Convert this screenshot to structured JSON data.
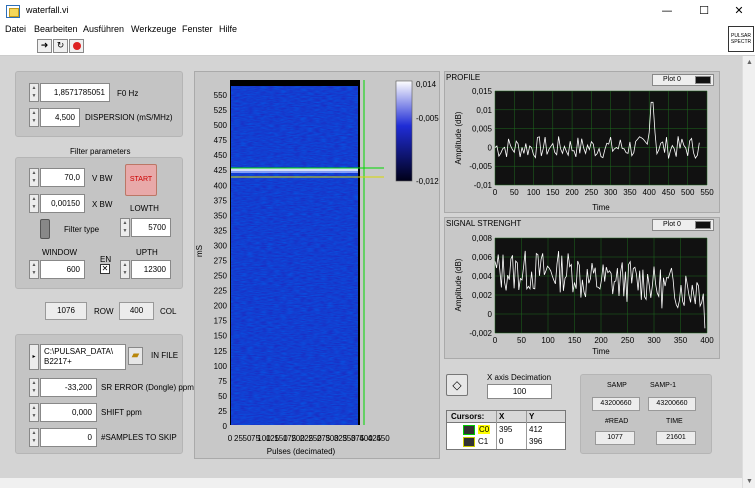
{
  "window": {
    "title": "waterfall.vi"
  },
  "menu": [
    "Datei",
    "Bearbeiten",
    "Ausführen",
    "Werkzeuge",
    "Fenster",
    "Hilfe"
  ],
  "logo": "PULSAR SPECTR",
  "controls": {
    "f0": {
      "value": "1,8571785051",
      "label": "F0 Hz"
    },
    "dispersion": {
      "value": "4,500",
      "label": "DISPERSION (mS/MHz)"
    },
    "filter_title": "Filter parameters",
    "vbw": {
      "value": "70,0",
      "label": "V BW"
    },
    "xbw": {
      "value": "0,00150",
      "label": "X BW"
    },
    "start_label": "START",
    "lowth": {
      "value": "5700",
      "label": "LOWTH"
    },
    "filter_type": "Filter type",
    "window": {
      "value": "600",
      "label": "WINDOW"
    },
    "en": "EN",
    "upth": {
      "value": "12300",
      "label": "UPTH"
    },
    "row": {
      "value": "1076",
      "label": "ROW"
    },
    "col": {
      "value": "400",
      "label": "COL"
    },
    "infile": {
      "value": "C:\\PULSAR_DATA\\ B2217+",
      "label": "IN FILE"
    },
    "sr_error": {
      "value": "-33,200",
      "label": "SR ERROR (Dongle) ppm"
    },
    "shift": {
      "value": "0,000",
      "label": "SHIFT ppm"
    },
    "skip": {
      "value": "0",
      "label": "#SAMPLES TO SKIP"
    }
  },
  "waterfall": {
    "ylabel": "mS",
    "xlabel": "Pulses (decimated)",
    "yticks": [
      "0",
      "25",
      "50",
      "75",
      "100",
      "125",
      "150",
      "175",
      "200",
      "225",
      "250",
      "275",
      "300",
      "325",
      "350",
      "375",
      "400",
      "425",
      "450",
      "475",
      "500",
      "525",
      "550"
    ],
    "xticks": [
      "0",
      "25",
      "50",
      "75",
      "100",
      "125",
      "150",
      "175",
      "200",
      "225",
      "250",
      "275",
      "300",
      "325",
      "350",
      "375",
      "400",
      "425",
      "450"
    ],
    "colorbar": [
      "0,014",
      "-0,005",
      "-0,012"
    ],
    "pulse_row_ms": 400,
    "cursor_x": 395,
    "cursor_y": 412
  },
  "profile": {
    "title": "PROFILE",
    "plot_label": "Plot 0",
    "ylabel": "Amplitude (dB)",
    "xlabel": "Time",
    "yticks": [
      "0,015",
      "0,01",
      "0,005",
      "0",
      "-0,005",
      "-0,01"
    ],
    "xticks": [
      "0",
      "50",
      "100",
      "150",
      "200",
      "250",
      "300",
      "350",
      "400",
      "450",
      "500",
      "550"
    ]
  },
  "signal": {
    "title": "SIGNAL STRENGHT",
    "plot_label": "Plot 0",
    "ylabel": "Amplitude (dB)",
    "xlabel": "Time",
    "yticks": [
      "0,008",
      "0,006",
      "0,004",
      "0,002",
      "0",
      "-0,002"
    ],
    "xticks": [
      "0",
      "50",
      "100",
      "150",
      "200",
      "250",
      "300",
      "350",
      "400"
    ]
  },
  "decimation": {
    "label": "X axis Decimation",
    "value": "100"
  },
  "cursors": {
    "headers": [
      "Cursors:",
      "X",
      "Y"
    ],
    "rows": [
      {
        "name": "C0",
        "x": "395",
        "y": "412"
      },
      {
        "name": "C1",
        "x": "0",
        "y": "396"
      }
    ]
  },
  "stats": {
    "samp_label": "SAMP",
    "samp": "43200660",
    "samp1_label": "SAMP-1",
    "samp1": "43200660",
    "read_label": "#READ",
    "read": "1077",
    "time_label": "TIME",
    "time": "21601"
  }
}
